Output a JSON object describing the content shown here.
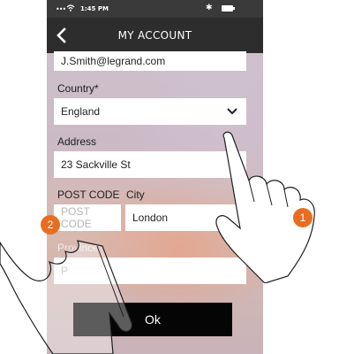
{
  "status_bar": {
    "signal": "•••",
    "time": "1:45 PM",
    "bluetooth": "✱"
  },
  "header": {
    "title": "MY ACCOUNT",
    "back_icon": "chevron-left-icon"
  },
  "form": {
    "email_value": "J.Smith@legrand.com",
    "country_label": "Country*",
    "country_value": "England",
    "address_label": "Address",
    "address_value": "23 Sackville St",
    "postcode_label": "POST CODE",
    "postcode_placeholder": "POST CODE",
    "city_label": "City",
    "city_value": "London",
    "province_label": "Province",
    "province_placeholder": "P"
  },
  "ok_label": "Ok",
  "callouts": {
    "badge_1": "1",
    "badge_2": "2"
  },
  "colors": {
    "accent": "#e76e21",
    "bar": "#2d2d2d",
    "button": "#050505"
  }
}
